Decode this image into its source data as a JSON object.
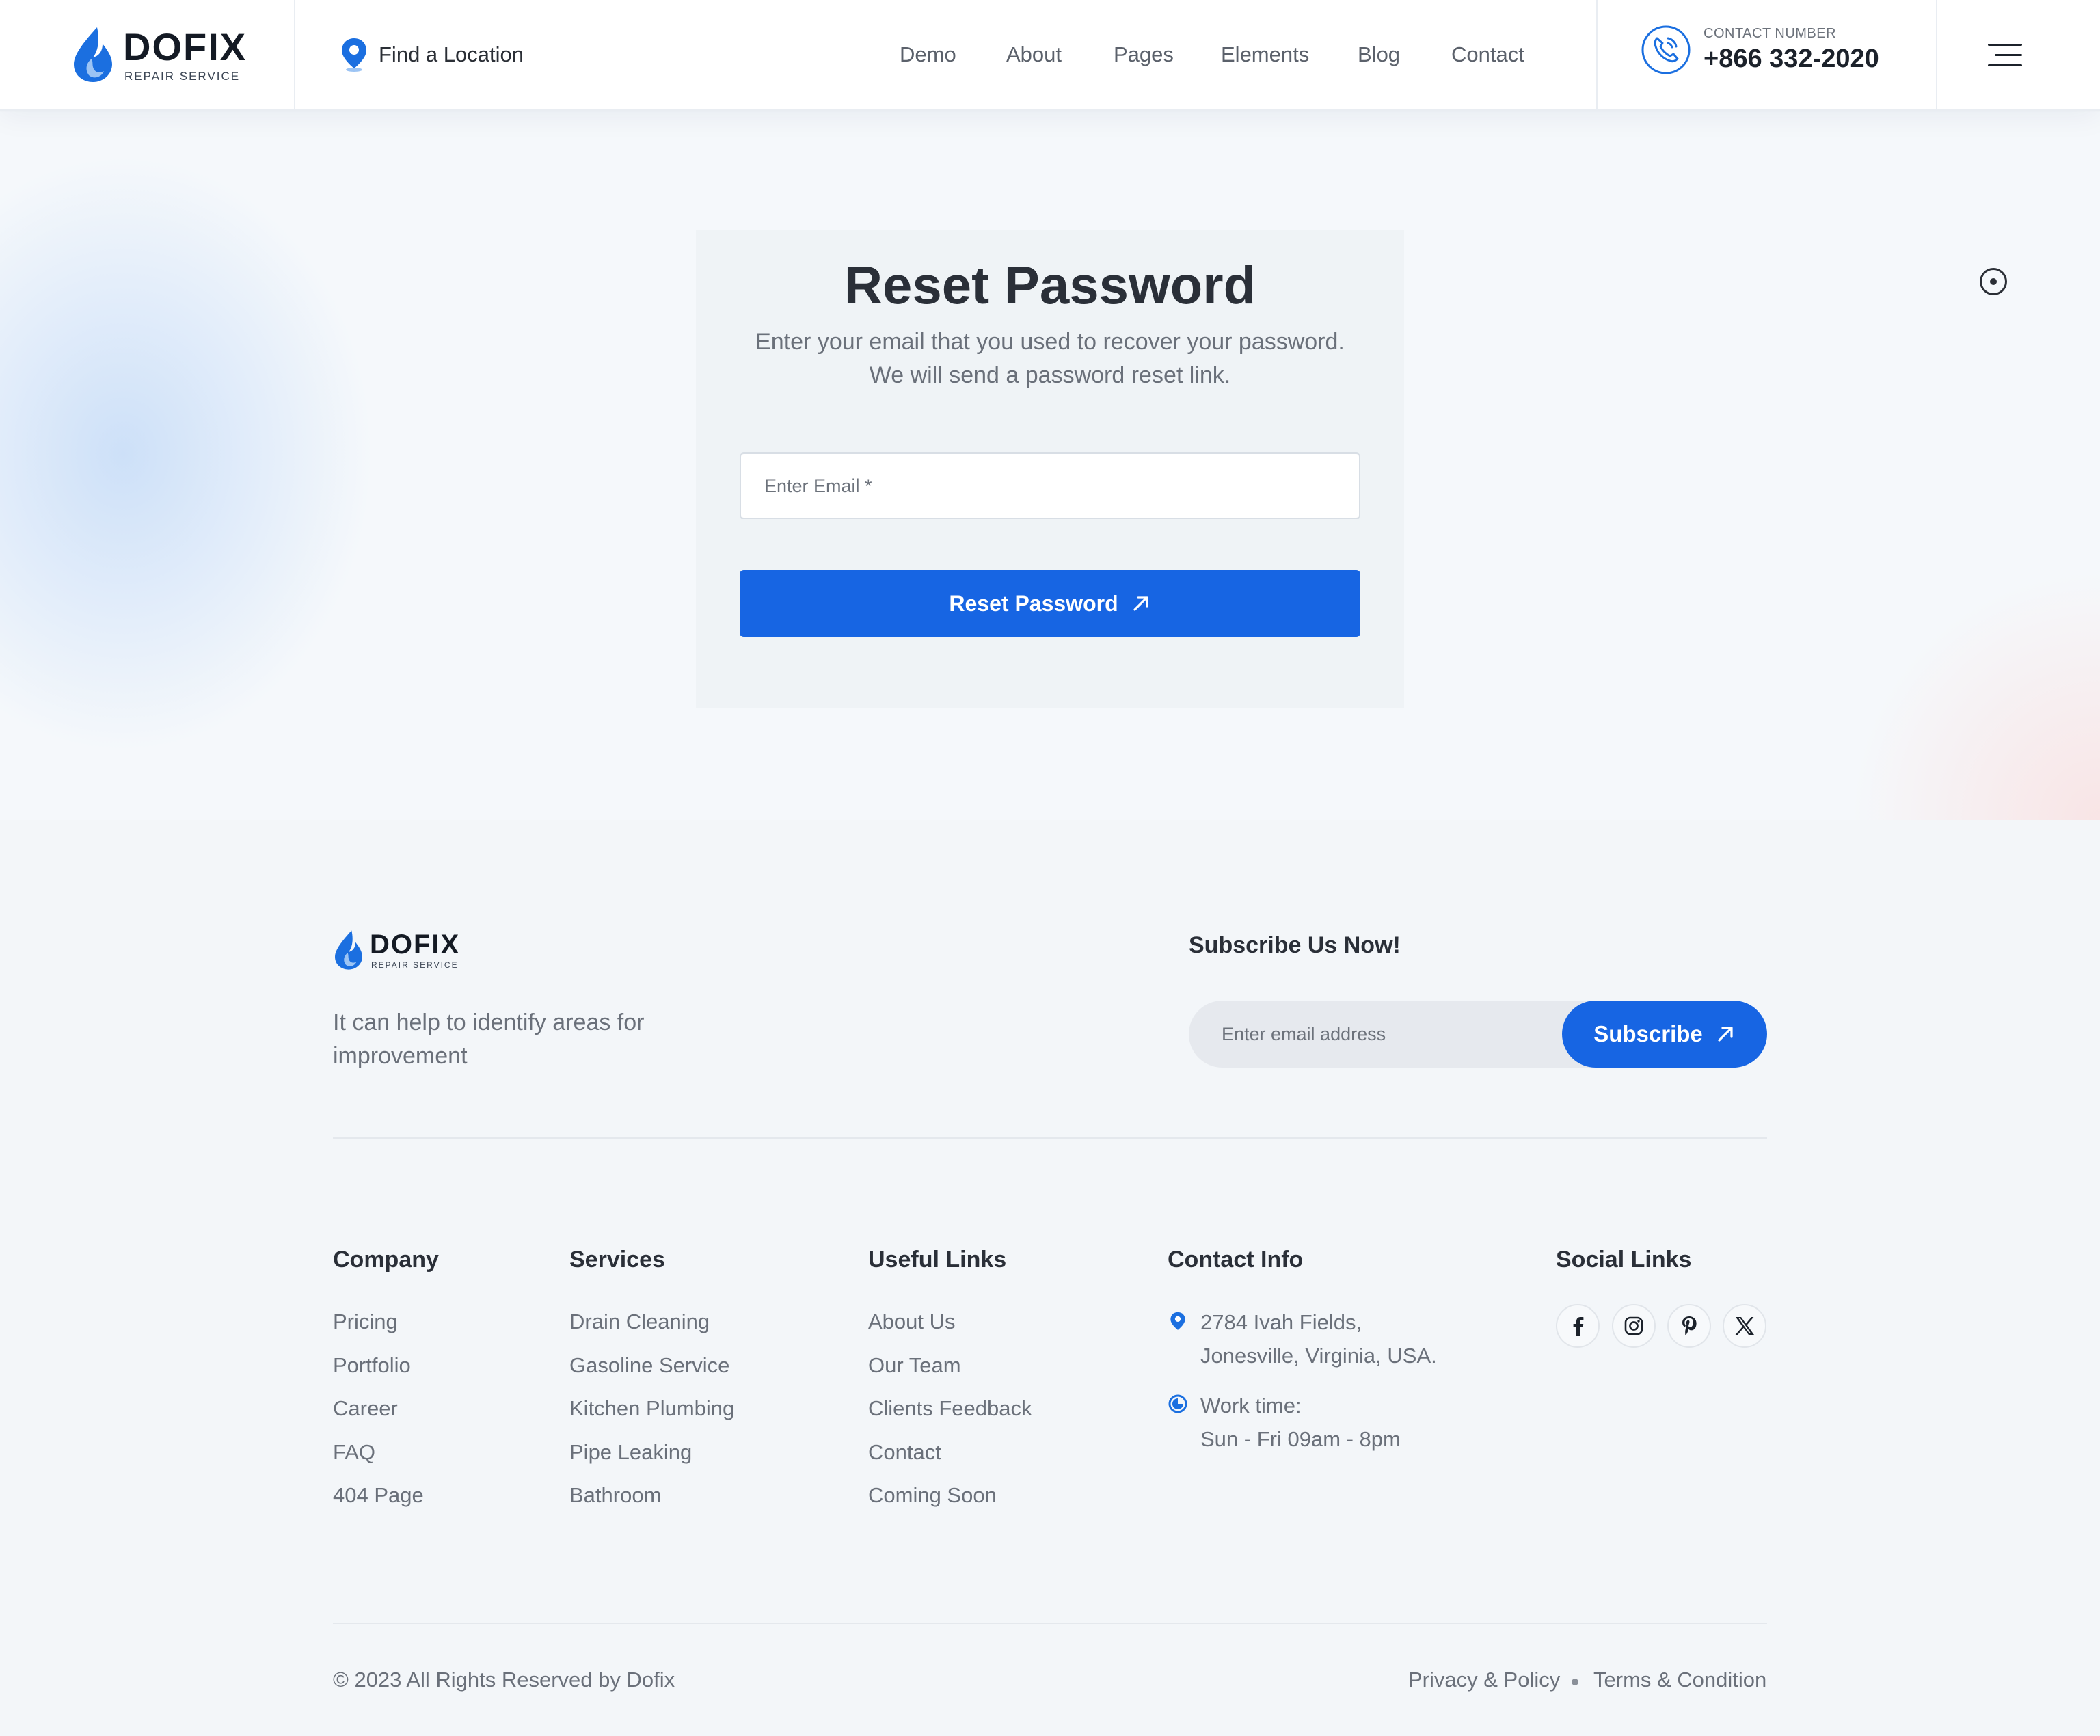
{
  "colors": {
    "accent": "#1765e3",
    "text_dark": "#2a2f38",
    "text_muted": "#6a707a",
    "background": "#f3f6f9"
  },
  "header": {
    "logo": {
      "name": "DOFIX",
      "tagline": "REPAIR SERVICE"
    },
    "find_location": "Find a Location",
    "nav": [
      "Demo",
      "About",
      "Pages",
      "Elements",
      "Blog",
      "Contact"
    ],
    "contact": {
      "label": "CONTACT NUMBER",
      "number": "+866 332-2020"
    }
  },
  "reset": {
    "title": "Reset Password",
    "description_line1": "Enter your email that you used to recover your password.",
    "description_line2": "We will send a password reset link.",
    "email_placeholder": "Enter Email *",
    "button_label": "Reset Password"
  },
  "footer": {
    "logo": {
      "name": "DOFIX",
      "tagline": "REPAIR SERVICE"
    },
    "about_line1": "It can help to identify areas for",
    "about_line2": "improvement",
    "subscribe": {
      "title": "Subscribe Us Now!",
      "placeholder": "Enter email address",
      "button_label": "Subscribe"
    },
    "columns": {
      "company": {
        "title": "Company",
        "links": [
          "Pricing",
          "Portfolio",
          "Career",
          "FAQ",
          "404 Page"
        ]
      },
      "services": {
        "title": "Services",
        "links": [
          "Drain Cleaning",
          "Gasoline Service",
          "Kitchen Plumbing",
          "Pipe Leaking",
          "Bathroom"
        ]
      },
      "useful": {
        "title": "Useful Links",
        "links": [
          "About Us",
          "Our Team",
          "Clients Feedback",
          "Contact",
          "Coming Soon"
        ]
      },
      "contact_info": {
        "title": "Contact Info",
        "address_line1": "2784 Ivah Fields,",
        "address_line2": "Jonesville, Virginia, USA.",
        "work_label": "Work time:",
        "work_hours": "Sun - Fri 09am - 8pm"
      },
      "social": {
        "title": "Social Links",
        "icons": [
          "facebook-icon",
          "instagram-icon",
          "pinterest-icon",
          "x-icon"
        ]
      }
    },
    "copyright": "© 2023 All Rights Reserved by Dofix",
    "legal": [
      "Privacy & Policy",
      "Terms & Condition"
    ]
  }
}
